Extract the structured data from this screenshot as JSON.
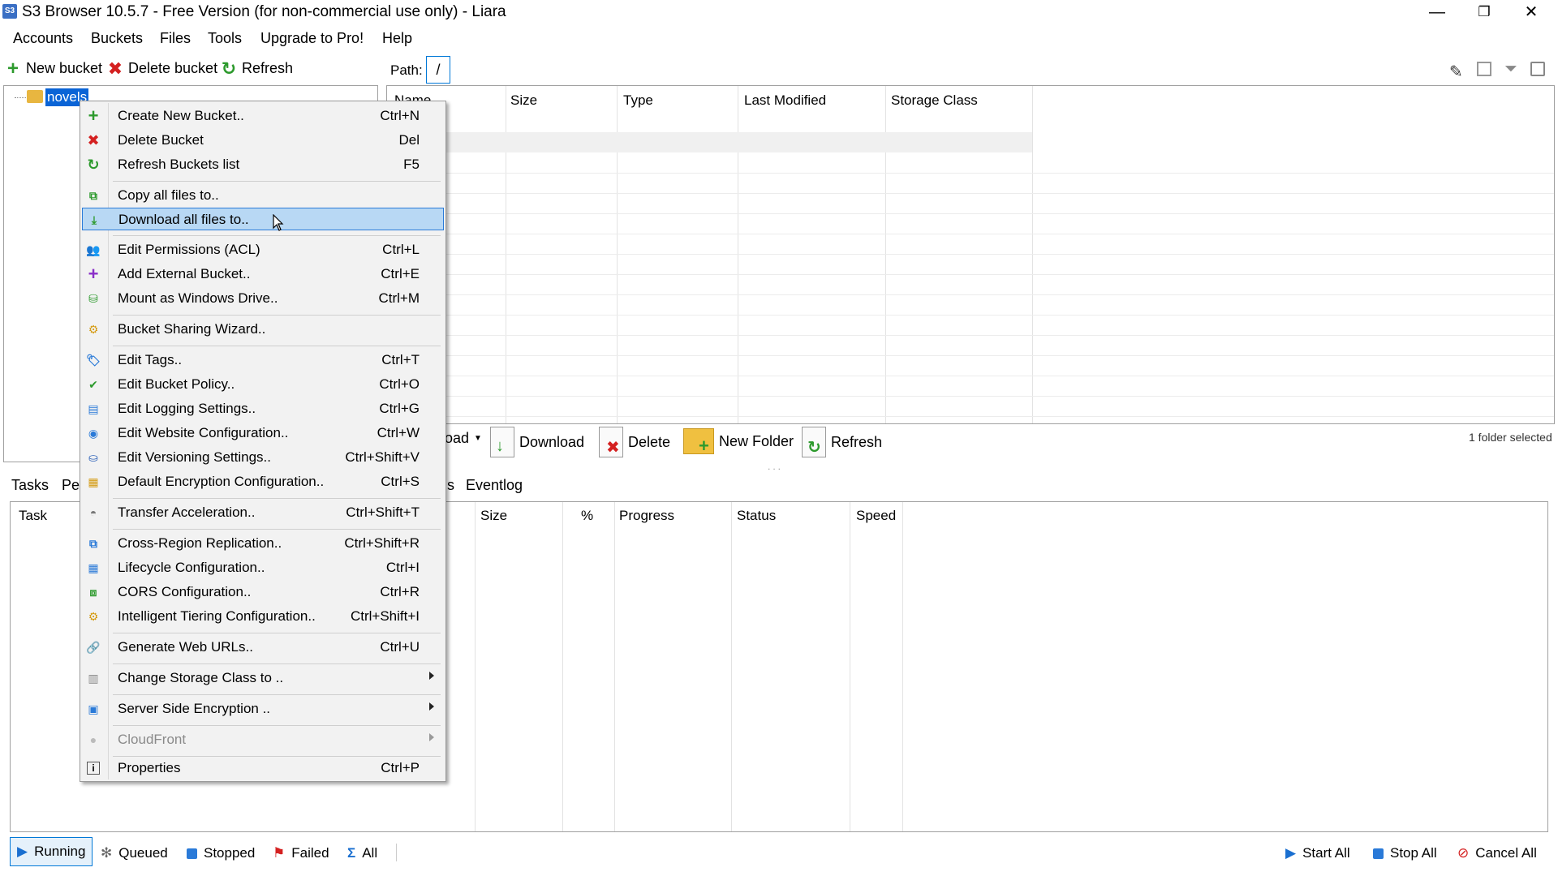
{
  "window": {
    "title": "S3 Browser 10.5.7 - Free Version (for non-commercial use only) - Liara",
    "icon_label": "S3",
    "minimize": "—",
    "maximize": "❐",
    "close": "✕"
  },
  "menubar": [
    "Accounts",
    "Buckets",
    "Files",
    "Tools",
    "Upgrade to Pro!",
    "Help"
  ],
  "toolbar": {
    "new_bucket": "New bucket",
    "delete_bucket": "Delete bucket",
    "refresh": "Refresh"
  },
  "tree": {
    "selected_bucket": "novels"
  },
  "path": {
    "label": "Path:",
    "value": "/"
  },
  "file_table": {
    "columns": [
      "Name",
      "Size",
      "Type",
      "Last Modified",
      "Storage Class"
    ]
  },
  "file_toolbar": {
    "upload_partial": "oad",
    "download": "Download",
    "delete": "Delete",
    "new_folder": "New Folder",
    "refresh": "Refresh",
    "selection_info": "1 folder selected"
  },
  "tabs": {
    "tasks": "Tasks",
    "permissions_partial": "Pe",
    "partial_s": "s",
    "eventlog": "Eventlog"
  },
  "task_table": {
    "columns": [
      "Task",
      "Size",
      "%",
      "Progress",
      "Status",
      "Speed"
    ]
  },
  "statusbar": {
    "running": "Running",
    "queued": "Queued",
    "stopped": "Stopped",
    "failed": "Failed",
    "all": "All",
    "start_all": "Start All",
    "stop_all": "Stop All",
    "cancel_all": "Cancel All"
  },
  "context_menu": {
    "items": [
      {
        "label": "Create New Bucket..",
        "shortcut": "Ctrl+N",
        "icon": "plus-icon"
      },
      {
        "label": "Delete Bucket",
        "shortcut": "Del",
        "icon": "delete-icon"
      },
      {
        "label": "Refresh Buckets list",
        "shortcut": "F5",
        "icon": "refresh-icon"
      },
      {
        "label": "Copy all files to..",
        "shortcut": "",
        "icon": "copy-icon"
      },
      {
        "label": "Download all files to..",
        "shortcut": "",
        "icon": "download-icon"
      },
      {
        "label": "Edit Permissions (ACL)",
        "shortcut": "Ctrl+L",
        "icon": "users-icon"
      },
      {
        "label": "Add External Bucket..",
        "shortcut": "Ctrl+E",
        "icon": "purple-plus-icon"
      },
      {
        "label": "Mount as Windows Drive..",
        "shortcut": "Ctrl+M",
        "icon": "drive-icon"
      },
      {
        "label": "Bucket Sharing Wizard..",
        "shortcut": "",
        "icon": "wizard-icon"
      },
      {
        "label": "Edit Tags..",
        "shortcut": "Ctrl+T",
        "icon": "tag-icon"
      },
      {
        "label": "Edit Bucket Policy..",
        "shortcut": "Ctrl+O",
        "icon": "policy-icon"
      },
      {
        "label": "Edit Logging Settings..",
        "shortcut": "Ctrl+G",
        "icon": "logging-icon"
      },
      {
        "label": "Edit Website Configuration..",
        "shortcut": "Ctrl+W",
        "icon": "globe-icon"
      },
      {
        "label": "Edit Versioning Settings..",
        "shortcut": "Ctrl+Shift+V",
        "icon": "versioning-icon"
      },
      {
        "label": "Default Encryption Configuration..",
        "shortcut": "Ctrl+S",
        "icon": "encryption-icon"
      },
      {
        "label": "Transfer Acceleration..",
        "shortcut": "Ctrl+Shift+T",
        "icon": "acceleration-icon"
      },
      {
        "label": "Cross-Region Replication..",
        "shortcut": "Ctrl+Shift+R",
        "icon": "replication-icon"
      },
      {
        "label": "Lifecycle Configuration..",
        "shortcut": "Ctrl+I",
        "icon": "lifecycle-icon"
      },
      {
        "label": "CORS Configuration..",
        "shortcut": "Ctrl+R",
        "icon": "cors-icon"
      },
      {
        "label": "Intelligent Tiering Configuration..",
        "shortcut": "Ctrl+Shift+I",
        "icon": "tiering-icon"
      },
      {
        "label": "Generate Web URLs..",
        "shortcut": "Ctrl+U",
        "icon": "url-icon"
      },
      {
        "label": "Change Storage Class to ..",
        "shortcut": "",
        "icon": "storage-icon"
      },
      {
        "label": "Server Side Encryption ..",
        "shortcut": "",
        "icon": "sse-icon"
      },
      {
        "label": "CloudFront",
        "shortcut": "",
        "icon": "cloudfront-icon"
      },
      {
        "label": "Properties",
        "shortcut": "Ctrl+P",
        "icon": "info-icon"
      }
    ]
  },
  "colors": {
    "accent": "#0078d7",
    "highlight": "#b8d8f4",
    "tree_selection": "#0a64d6"
  }
}
